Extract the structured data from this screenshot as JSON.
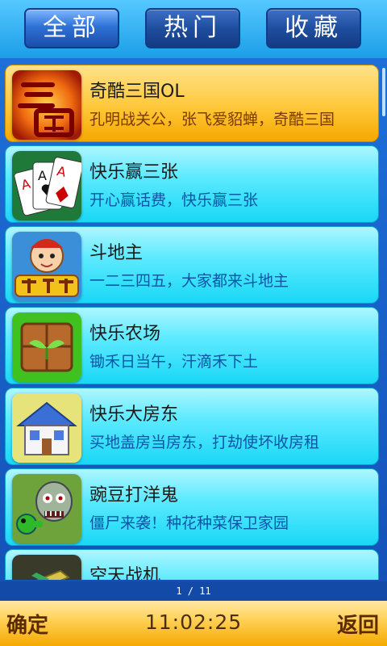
{
  "tabs": [
    {
      "label": "全部",
      "active": true
    },
    {
      "label": "热门",
      "active": false
    },
    {
      "label": "收藏",
      "active": false
    }
  ],
  "items": [
    {
      "title": "奇酷三国OL",
      "desc": "孔明战关公，张飞爱貂蝉，奇酷三国",
      "icon": "three-kingdoms-icon",
      "selected": true
    },
    {
      "title": "快乐赢三张",
      "desc": "开心赢话费，快乐赢三张",
      "icon": "poker-cards-icon"
    },
    {
      "title": "斗地主",
      "desc": "一二三四五，大家都来斗地主",
      "icon": "doudizhu-icon"
    },
    {
      "title": "快乐农场",
      "desc": "锄禾日当午，汗滴禾下土",
      "icon": "farm-seedling-icon"
    },
    {
      "title": "快乐大房东",
      "desc": "买地盖房当房东，打劫使坏收房租",
      "icon": "house-icon"
    },
    {
      "title": "豌豆打洋鬼",
      "desc": "僵尸来袭！种花种菜保卫家园",
      "icon": "zombie-plant-icon"
    },
    {
      "title": "空天战机",
      "desc": "",
      "icon": "fighter-jet-icon"
    }
  ],
  "pager": {
    "text": "1 / 11"
  },
  "bottom": {
    "left_label": "确定",
    "time": "11:02:25",
    "right_label": "返回"
  },
  "colors": {
    "accent": "#1a4ea9",
    "item_bg": "#19d7f5",
    "selected_bg": "#ffc83a"
  }
}
